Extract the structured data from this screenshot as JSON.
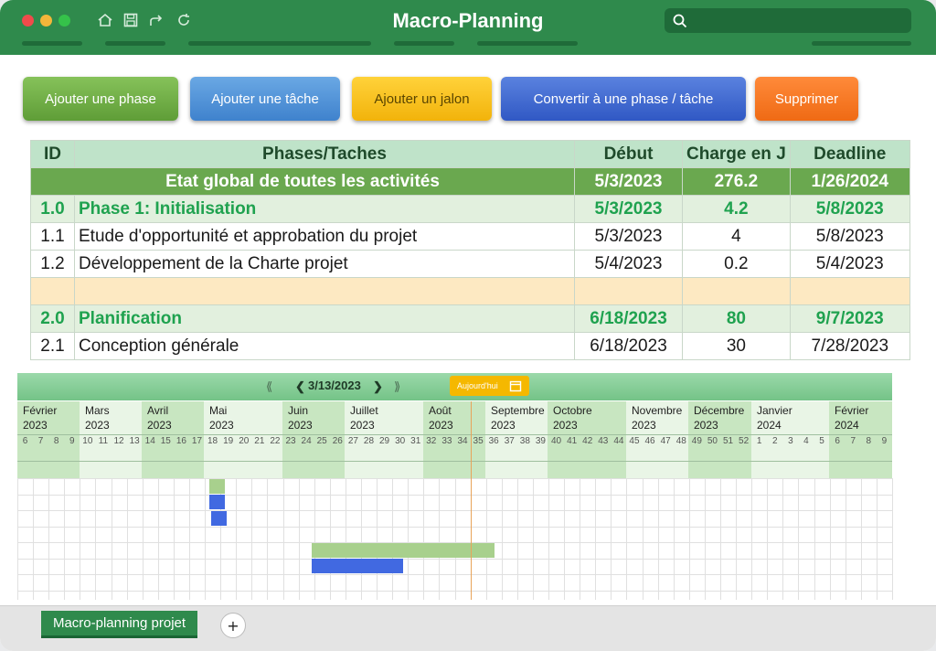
{
  "window": {
    "title": "Macro-Planning"
  },
  "toolbar": {
    "add_phase": "Ajouter une phase",
    "add_task": "Ajouter une tâche",
    "add_milestone": "Ajouter un jalon",
    "convert": "Convertir à une phase / tâche",
    "delete": "Supprimer"
  },
  "table": {
    "headers": {
      "id": "ID",
      "name": "Phases/Taches",
      "start": "Début",
      "charge": "Charge en J",
      "deadline": "Deadline"
    },
    "global": {
      "name": "Etat global de toutes les activités",
      "start": "5/3/2023",
      "charge": "276.2",
      "deadline": "1/26/2024"
    },
    "rows": [
      {
        "kind": "phase",
        "id": "1.0",
        "name": "Phase 1: Initialisation",
        "start": "5/3/2023",
        "charge": "4.2",
        "deadline": "5/8/2023"
      },
      {
        "kind": "task",
        "id": "1.1",
        "name": "Etude d'opportunité et approbation du projet",
        "start": "5/3/2023",
        "charge": "4",
        "deadline": "5/8/2023"
      },
      {
        "kind": "task",
        "id": "1.2",
        "name": "Développement de la Charte projet",
        "start": "5/4/2023",
        "charge": "0.2",
        "deadline": "5/4/2023"
      },
      {
        "kind": "empty",
        "id": "",
        "name": "",
        "start": "",
        "charge": "",
        "deadline": ""
      },
      {
        "kind": "phase",
        "id": "2.0",
        "name": "Planification",
        "start": "6/18/2023",
        "charge": "80",
        "deadline": "9/7/2023"
      },
      {
        "kind": "task",
        "id": "2.1",
        "name": "Conception générale",
        "start": "6/18/2023",
        "charge": "30",
        "deadline": "7/28/2023"
      }
    ]
  },
  "gantt": {
    "nav_prev_fast": "⟪",
    "nav_prev": "❮",
    "current_date": "3/13/2023",
    "nav_next": "❯",
    "nav_next_fast": "⟫",
    "today_label": "Aujourd'hui",
    "months": [
      {
        "name": "Février",
        "year": "2023",
        "shade": true
      },
      {
        "name": "Mars",
        "year": "2023",
        "shade": false
      },
      {
        "name": "Avril",
        "year": "2023",
        "shade": true
      },
      {
        "name": "Mai",
        "year": "2023",
        "shade": false
      },
      {
        "name": "Juin",
        "year": "2023",
        "shade": true
      },
      {
        "name": "Juillet",
        "year": "2023",
        "shade": false
      },
      {
        "name": "Août",
        "year": "2023",
        "shade": true
      },
      {
        "name": "Septembre",
        "year": "2023",
        "shade": false
      },
      {
        "name": "Octobre",
        "year": "2023",
        "shade": true
      },
      {
        "name": "Novembre",
        "year": "2023",
        "shade": false
      },
      {
        "name": "Décembre",
        "year": "2023",
        "shade": true
      },
      {
        "name": "Janvier",
        "year": "2024",
        "shade": false
      },
      {
        "name": "Février",
        "year": "2024",
        "shade": true
      }
    ],
    "weeks": [
      "6",
      "7",
      "8",
      "9",
      "10",
      "11",
      "12",
      "13",
      "14",
      "15",
      "16",
      "17",
      "18",
      "19",
      "20",
      "21",
      "22",
      "23",
      "24",
      "25",
      "26",
      "27",
      "28",
      "29",
      "30",
      "31",
      "32",
      "33",
      "34",
      "35",
      "36",
      "37",
      "38",
      "39",
      "40",
      "41",
      "42",
      "43",
      "44",
      "45",
      "46",
      "47",
      "48",
      "49",
      "50",
      "51",
      "52",
      "1",
      "2",
      "3",
      "4",
      "5",
      "6",
      "7",
      "8",
      "9"
    ],
    "colors": {
      "phase": "#a8d08d",
      "task": "#4169e1",
      "today": "#e8a35a",
      "shade": "#c8e6c1",
      "light": "#e9f5e6"
    }
  },
  "sheet_tabs": {
    "active": "Macro-planning projet",
    "add": "+"
  }
}
